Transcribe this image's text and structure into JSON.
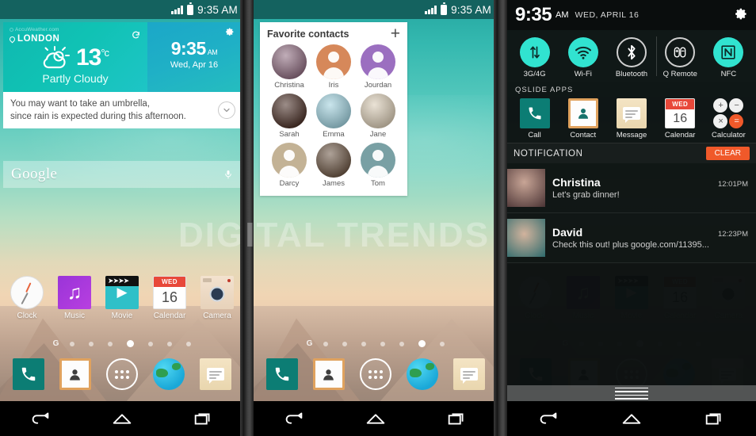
{
  "statusbar": {
    "time": "9:35 AM"
  },
  "watermark": "DIGITAL TRENDS",
  "weather_widget": {
    "source": "AccuWeather.com",
    "city": "LONDON",
    "temperature": "13",
    "unit": "°c",
    "condition": "Partly Cloudy",
    "clock_time": "9:35",
    "clock_ampm": "AM",
    "date": "Wed, Apr 16",
    "advisory_line1": "You may want to take an umbrella,",
    "advisory_line2": "since rain is expected during this afternoon."
  },
  "search": {
    "logo": "Google",
    "mic_icon": "microphone-icon"
  },
  "home_apps": [
    {
      "label": "Clock",
      "icon": "clock-icon"
    },
    {
      "label": "Music",
      "icon": "music-note-icon"
    },
    {
      "label": "Movie",
      "icon": "movie-clapper-icon"
    },
    {
      "label": "Calendar",
      "icon": "calendar-icon",
      "day_header": "WED",
      "day_number": "16"
    },
    {
      "label": "Camera",
      "icon": "camera-icon"
    }
  ],
  "page_dots": {
    "google_label": "G",
    "count": 7,
    "active_panel1": 3,
    "active_panel2": 5
  },
  "dock": [
    {
      "name": "phone-icon",
      "label": "Phone"
    },
    {
      "name": "contacts-icon",
      "label": "Contacts"
    },
    {
      "name": "app-drawer-icon",
      "label": "Apps"
    },
    {
      "name": "browser-icon",
      "label": "Browser"
    },
    {
      "name": "messaging-icon",
      "label": "Messaging"
    }
  ],
  "navbar": [
    {
      "name": "back-icon",
      "label": "Back"
    },
    {
      "name": "home-icon",
      "label": "Home"
    },
    {
      "name": "recents-icon",
      "label": "Recent apps"
    }
  ],
  "favorites": {
    "title": "Favorite contacts",
    "add_label": "+",
    "contacts": [
      {
        "name": "Christina",
        "type": "photo",
        "color": "#8d6a7e"
      },
      {
        "name": "Iris",
        "type": "avatar",
        "color": "#d6885a"
      },
      {
        "name": "Jourdan",
        "type": "avatar",
        "color": "#9b6fc0"
      },
      {
        "name": "Sarah",
        "type": "photo",
        "color": "#4a2f26"
      },
      {
        "name": "Emma",
        "type": "photo",
        "color": "#9ed0dd"
      },
      {
        "name": "Jane",
        "type": "photo",
        "color": "#d9cbb4"
      },
      {
        "name": "Darcy",
        "type": "avatar",
        "color": "#c3b295"
      },
      {
        "name": "James",
        "type": "photo",
        "color": "#6b5543"
      },
      {
        "name": "Tom",
        "type": "avatar",
        "color": "#79a0a4"
      }
    ]
  },
  "shade": {
    "time": "9:35",
    "ampm": "AM",
    "date": "WED, APRIL 16",
    "settings_icon": "gear-icon",
    "toggles": [
      {
        "label": "3G/4G",
        "icon": "data-transfer-icon",
        "state": "on"
      },
      {
        "label": "Wi-Fi",
        "icon": "wifi-icon",
        "state": "on"
      },
      {
        "label": "Bluetooth",
        "icon": "bluetooth-icon",
        "state": "off"
      },
      {
        "label": "Q Remote",
        "icon": "remote-icon",
        "state": "off"
      },
      {
        "label": "NFC",
        "icon": "nfc-icon",
        "state": "on"
      }
    ],
    "qslide_header": "QSLIDE APPS",
    "qslide_apps": [
      {
        "label": "Call",
        "icon": "phone-icon"
      },
      {
        "label": "Contact",
        "icon": "contacts-icon"
      },
      {
        "label": "Message",
        "icon": "messaging-icon"
      },
      {
        "label": "Calendar",
        "icon": "calendar-icon",
        "day_header": "WED",
        "day_number": "16"
      },
      {
        "label": "Calculator",
        "icon": "calculator-icon",
        "keys": [
          "+",
          "−",
          "×",
          "="
        ]
      }
    ],
    "notification_header": "NOTIFICATION",
    "clear_label": "CLEAR",
    "notifications": [
      {
        "name": "Christina",
        "text": "Let's grab dinner!",
        "time": "12:01PM"
      },
      {
        "name": "David",
        "text": "Check this out! plus google.com/11395...",
        "time": "12:23PM"
      }
    ],
    "handle_icon": "drag-handle-icon"
  },
  "colors": {
    "accent_teal": "#31e3d0",
    "status_bar": "#14625f",
    "clear_orange": "#f0592a",
    "calendar_red": "#e8483a"
  }
}
